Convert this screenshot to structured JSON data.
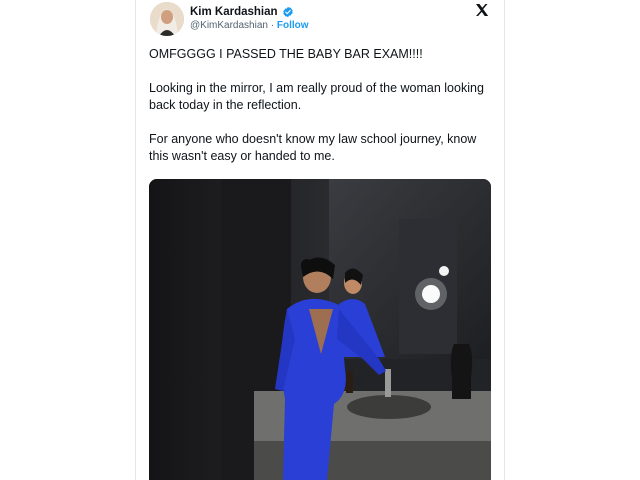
{
  "tweet": {
    "author_name": "Kim Kardashian",
    "author_handle": "@KimKardashian",
    "separator": "·",
    "follow_label": "Follow",
    "paragraphs": [
      "OMFGGGG I PASSED THE BABY BAR EXAM!!!!",
      "Looking in the mirror, I am really proud of the woman looking back today in the reflection.",
      "For anyone who doesn't know my law school journey, know this wasn't easy or handed to me."
    ]
  },
  "icons": {
    "verified": "verified-badge-icon",
    "close": "x-logo-icon"
  },
  "colors": {
    "text": "#0f1419",
    "secondary": "#536471",
    "accent": "#1d9bf0",
    "dress": "#2a3fd6"
  }
}
